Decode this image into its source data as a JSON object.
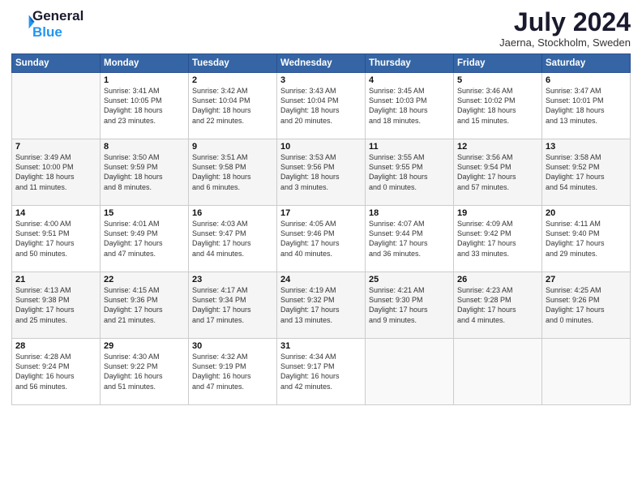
{
  "header": {
    "logo_line1": "General",
    "logo_line2": "Blue",
    "month": "July 2024",
    "location": "Jaerna, Stockholm, Sweden"
  },
  "weekdays": [
    "Sunday",
    "Monday",
    "Tuesday",
    "Wednesday",
    "Thursday",
    "Friday",
    "Saturday"
  ],
  "weeks": [
    [
      {
        "day": "",
        "content": ""
      },
      {
        "day": "1",
        "content": "Sunrise: 3:41 AM\nSunset: 10:05 PM\nDaylight: 18 hours\nand 23 minutes."
      },
      {
        "day": "2",
        "content": "Sunrise: 3:42 AM\nSunset: 10:04 PM\nDaylight: 18 hours\nand 22 minutes."
      },
      {
        "day": "3",
        "content": "Sunrise: 3:43 AM\nSunset: 10:04 PM\nDaylight: 18 hours\nand 20 minutes."
      },
      {
        "day": "4",
        "content": "Sunrise: 3:45 AM\nSunset: 10:03 PM\nDaylight: 18 hours\nand 18 minutes."
      },
      {
        "day": "5",
        "content": "Sunrise: 3:46 AM\nSunset: 10:02 PM\nDaylight: 18 hours\nand 15 minutes."
      },
      {
        "day": "6",
        "content": "Sunrise: 3:47 AM\nSunset: 10:01 PM\nDaylight: 18 hours\nand 13 minutes."
      }
    ],
    [
      {
        "day": "7",
        "content": "Sunrise: 3:49 AM\nSunset: 10:00 PM\nDaylight: 18 hours\nand 11 minutes."
      },
      {
        "day": "8",
        "content": "Sunrise: 3:50 AM\nSunset: 9:59 PM\nDaylight: 18 hours\nand 8 minutes."
      },
      {
        "day": "9",
        "content": "Sunrise: 3:51 AM\nSunset: 9:58 PM\nDaylight: 18 hours\nand 6 minutes."
      },
      {
        "day": "10",
        "content": "Sunrise: 3:53 AM\nSunset: 9:56 PM\nDaylight: 18 hours\nand 3 minutes."
      },
      {
        "day": "11",
        "content": "Sunrise: 3:55 AM\nSunset: 9:55 PM\nDaylight: 18 hours\nand 0 minutes."
      },
      {
        "day": "12",
        "content": "Sunrise: 3:56 AM\nSunset: 9:54 PM\nDaylight: 17 hours\nand 57 minutes."
      },
      {
        "day": "13",
        "content": "Sunrise: 3:58 AM\nSunset: 9:52 PM\nDaylight: 17 hours\nand 54 minutes."
      }
    ],
    [
      {
        "day": "14",
        "content": "Sunrise: 4:00 AM\nSunset: 9:51 PM\nDaylight: 17 hours\nand 50 minutes."
      },
      {
        "day": "15",
        "content": "Sunrise: 4:01 AM\nSunset: 9:49 PM\nDaylight: 17 hours\nand 47 minutes."
      },
      {
        "day": "16",
        "content": "Sunrise: 4:03 AM\nSunset: 9:47 PM\nDaylight: 17 hours\nand 44 minutes."
      },
      {
        "day": "17",
        "content": "Sunrise: 4:05 AM\nSunset: 9:46 PM\nDaylight: 17 hours\nand 40 minutes."
      },
      {
        "day": "18",
        "content": "Sunrise: 4:07 AM\nSunset: 9:44 PM\nDaylight: 17 hours\nand 36 minutes."
      },
      {
        "day": "19",
        "content": "Sunrise: 4:09 AM\nSunset: 9:42 PM\nDaylight: 17 hours\nand 33 minutes."
      },
      {
        "day": "20",
        "content": "Sunrise: 4:11 AM\nSunset: 9:40 PM\nDaylight: 17 hours\nand 29 minutes."
      }
    ],
    [
      {
        "day": "21",
        "content": "Sunrise: 4:13 AM\nSunset: 9:38 PM\nDaylight: 17 hours\nand 25 minutes."
      },
      {
        "day": "22",
        "content": "Sunrise: 4:15 AM\nSunset: 9:36 PM\nDaylight: 17 hours\nand 21 minutes."
      },
      {
        "day": "23",
        "content": "Sunrise: 4:17 AM\nSunset: 9:34 PM\nDaylight: 17 hours\nand 17 minutes."
      },
      {
        "day": "24",
        "content": "Sunrise: 4:19 AM\nSunset: 9:32 PM\nDaylight: 17 hours\nand 13 minutes."
      },
      {
        "day": "25",
        "content": "Sunrise: 4:21 AM\nSunset: 9:30 PM\nDaylight: 17 hours\nand 9 minutes."
      },
      {
        "day": "26",
        "content": "Sunrise: 4:23 AM\nSunset: 9:28 PM\nDaylight: 17 hours\nand 4 minutes."
      },
      {
        "day": "27",
        "content": "Sunrise: 4:25 AM\nSunset: 9:26 PM\nDaylight: 17 hours\nand 0 minutes."
      }
    ],
    [
      {
        "day": "28",
        "content": "Sunrise: 4:28 AM\nSunset: 9:24 PM\nDaylight: 16 hours\nand 56 minutes."
      },
      {
        "day": "29",
        "content": "Sunrise: 4:30 AM\nSunset: 9:22 PM\nDaylight: 16 hours\nand 51 minutes."
      },
      {
        "day": "30",
        "content": "Sunrise: 4:32 AM\nSunset: 9:19 PM\nDaylight: 16 hours\nand 47 minutes."
      },
      {
        "day": "31",
        "content": "Sunrise: 4:34 AM\nSunset: 9:17 PM\nDaylight: 16 hours\nand 42 minutes."
      },
      {
        "day": "",
        "content": ""
      },
      {
        "day": "",
        "content": ""
      },
      {
        "day": "",
        "content": ""
      }
    ]
  ]
}
